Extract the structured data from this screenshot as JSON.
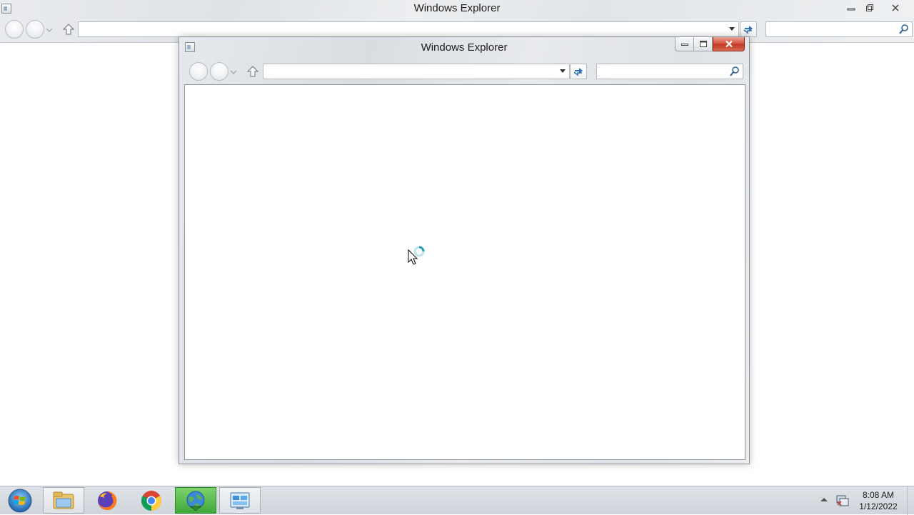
{
  "background_window": {
    "title": "Windows Explorer",
    "address_value": "",
    "search_placeholder": ""
  },
  "front_window": {
    "title": "Windows Explorer",
    "address_value": "",
    "search_placeholder": ""
  },
  "taskbar": {
    "items": [
      {
        "name": "start-button",
        "icon": "windows-orb-icon"
      },
      {
        "name": "file-explorer",
        "icon": "folder-icon"
      },
      {
        "name": "firefox",
        "icon": "firefox-icon"
      },
      {
        "name": "chrome",
        "icon": "chrome-icon"
      },
      {
        "name": "download-manager",
        "icon": "globe-download-icon"
      },
      {
        "name": "control-panel",
        "icon": "control-panel-icon"
      }
    ],
    "clock": {
      "time": "8:08 AM",
      "date": "1/12/2022"
    }
  },
  "colors": {
    "close_button": "#c8442d",
    "active_taskbar": "#3fa83a",
    "titlebar": "#e3e6ea"
  }
}
